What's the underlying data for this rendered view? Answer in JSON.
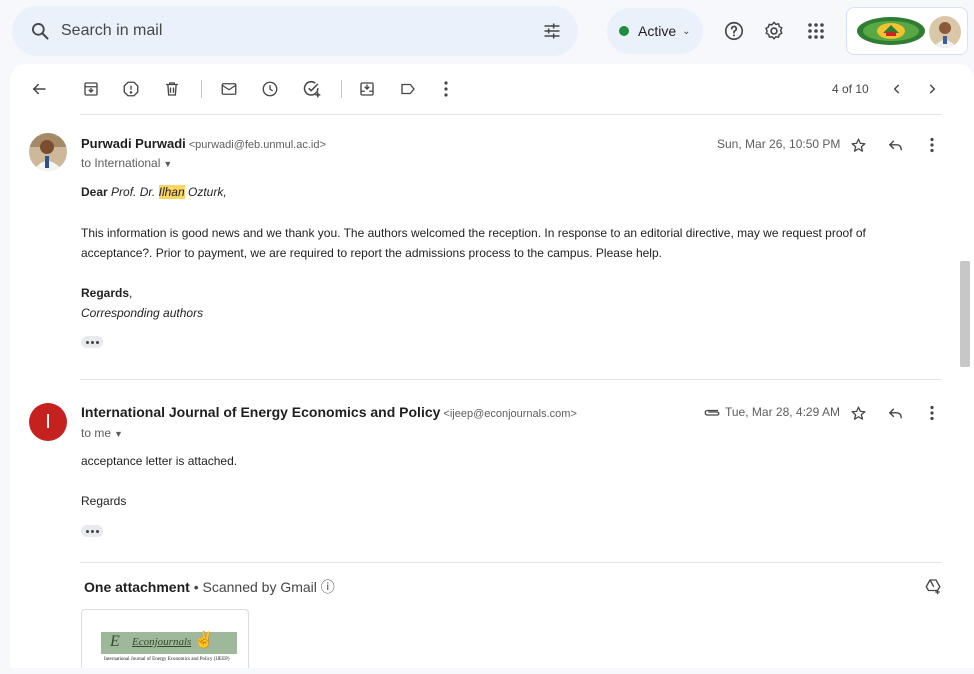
{
  "search": {
    "placeholder": "Search in mail"
  },
  "status": {
    "label": "Active",
    "color": "#1e8e3e"
  },
  "header_icons": [
    "help-icon",
    "settings-icon",
    "apps-grid-icon"
  ],
  "toolbar": {
    "icons": [
      "back-arrow-icon",
      "archive-icon",
      "report-spam-icon",
      "delete-icon",
      "mark-unread-icon",
      "snooze-icon",
      "add-to-tasks-icon",
      "move-to-icon",
      "label-icon",
      "more-vert-icon"
    ],
    "pager": "4 of 10"
  },
  "messages": [
    {
      "sender_name": "Purwadi Purwadi",
      "sender_email": "<purwadi@feb.unmul.ac.id>",
      "recipient": "to International",
      "date": "Sun, Mar 26, 10:50 PM",
      "greeting_bold": "Dear",
      "greeting_name_a": "Prof. Dr.",
      "greeting_name_highlight": "Ilhan",
      "greeting_name_b": "Ozturk,",
      "body_line1": "This information is good news and we thank you. The authors welcomed the reception. In response to an editorial directive, may we request proof of",
      "body_line2": "acceptance?. Prior to payment, we are required to report the admissions process to the campus. Please help.",
      "sign_bold": "Regards",
      "sign_comma": ",",
      "sign_italic": "Corresponding authors"
    },
    {
      "avatar_letter": "I",
      "avatar_color": "#c5221f",
      "sender_name": "International Journal of Energy Economics and Policy",
      "sender_email": "<ijeep@econjournals.com>",
      "recipient": "to me",
      "date": "Tue, Mar 28, 4:29 AM",
      "body_line1": "acceptance letter is attached.",
      "sign": "Regards"
    }
  ],
  "attachment": {
    "title": "One attachment",
    "separator": "•",
    "scan_label": "Scanned by Gmail",
    "thumbnail_journal": "International Journal of Energy Economics and Policy (IJEEP)",
    "thumbnail_logo": "Econjournals"
  }
}
